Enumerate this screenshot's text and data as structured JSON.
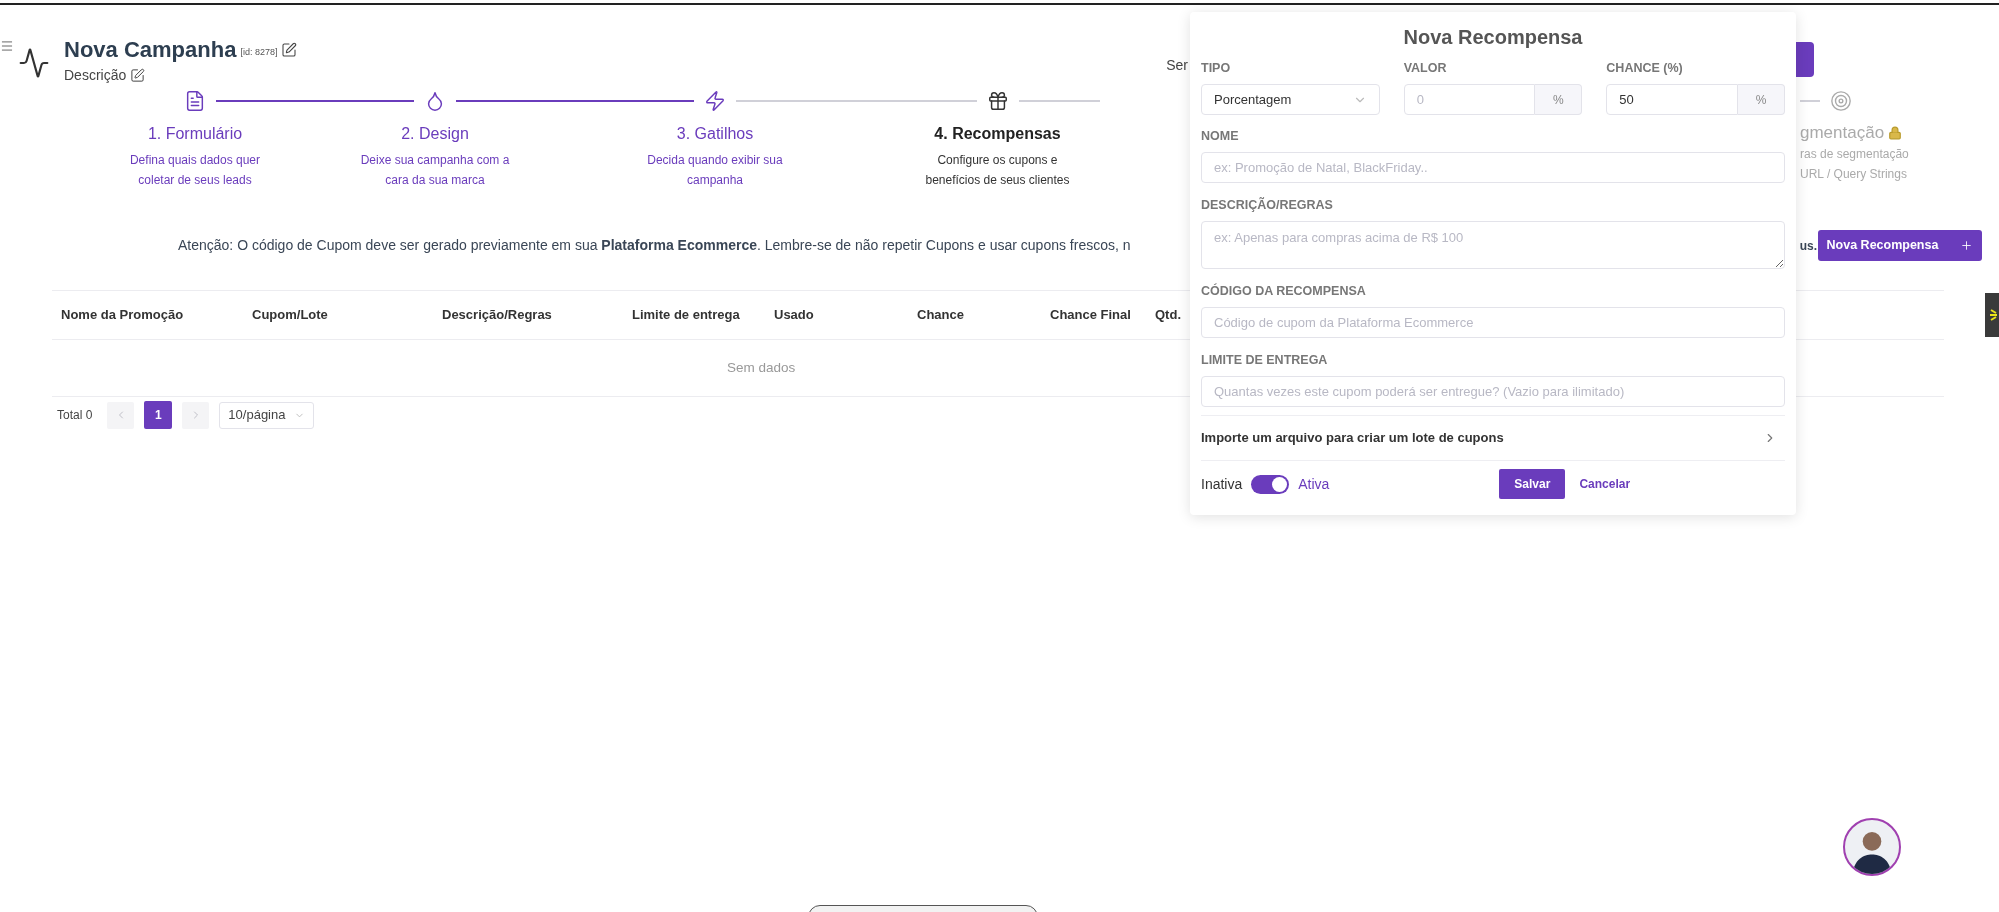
{
  "header": {
    "title": "Nova Campanha",
    "id_label": "[id: 8278]",
    "description": "Descrição",
    "partial_text": "Ser"
  },
  "steps": [
    {
      "title": "1. Formulário",
      "description": [
        "Defina quais dados quer",
        "coletar de seus leads"
      ],
      "completed": true,
      "selected": false
    },
    {
      "title": "2. Design",
      "description": [
        "Deixe sua campanha com a",
        "cara da sua marca"
      ],
      "completed": true,
      "selected": false
    },
    {
      "title": "3. Gatilhos",
      "description": [
        "Decida quando exibir sua",
        "campanha"
      ],
      "completed": true,
      "selected": false
    },
    {
      "title": "4. Recompensas",
      "description": [
        "Configure os cupons e",
        "benefícios de seus clientes"
      ],
      "completed": false,
      "selected": true
    }
  ],
  "partial_step": {
    "title": "gmentação",
    "description": [
      "ras de segmentação",
      "URL / Query Strings"
    ],
    "locked": true
  },
  "alert": {
    "text": "Atenção: O código de Cupom deve ser gerado previamente em sua **Plataforma Ecommerce**. Lembre-se de não repetir Cupons e usar cupons frescos, n",
    "tail": "us."
  },
  "new_button": "Nova Recompensa",
  "table": {
    "columns": [
      "Nome da Promoção",
      "Cupom/Lote",
      "Descrição/Regras",
      "Limite de entrega",
      "Usado",
      "Chance",
      "Chance Final",
      "Qtd."
    ],
    "empty": "Sem dados"
  },
  "pagination": {
    "total": "Total 0",
    "prev": {
      "disabled": true
    },
    "pages": [
      {
        "label": "1",
        "selected": true
      }
    ],
    "next": {
      "disabled": true
    },
    "page_size": "10/página"
  },
  "modal": {
    "title": "Nova Recompensa",
    "row": [
      {
        "label": "TIPO",
        "kind": "select",
        "value": "Porcentagem"
      },
      {
        "label": "VALOR",
        "kind": "addon",
        "placeholder": "0",
        "addon": "%"
      },
      {
        "label": "CHANCE (%)",
        "kind": "addon",
        "value": "50",
        "addon": "%"
      }
    ],
    "fields": [
      {
        "label": "NOME",
        "kind": "input",
        "placeholder": "ex: Promoção de Natal, BlackFriday.."
      },
      {
        "label": "DESCRIÇÃO/REGRAS",
        "kind": "textarea",
        "placeholder": "ex: Apenas para compras acima de R$ 100"
      },
      {
        "label": "CÓDIGO DA RECOMPENSA",
        "kind": "input",
        "placeholder": "Código de cupom da Plataforma Ecommerce"
      },
      {
        "label": "LIMITE DE ENTREGA",
        "kind": "input",
        "placeholder": "Quantas vezes este cupom poderá ser entregue? (Vazio para ilimitado)"
      }
    ],
    "import_row": "Importe um arquivo para criar um lote de cupons",
    "toggle": {
      "off_label": "Inativa",
      "on_label": "Ativa",
      "on": true
    },
    "save": "Salvar",
    "cancel": "Cancelar"
  }
}
